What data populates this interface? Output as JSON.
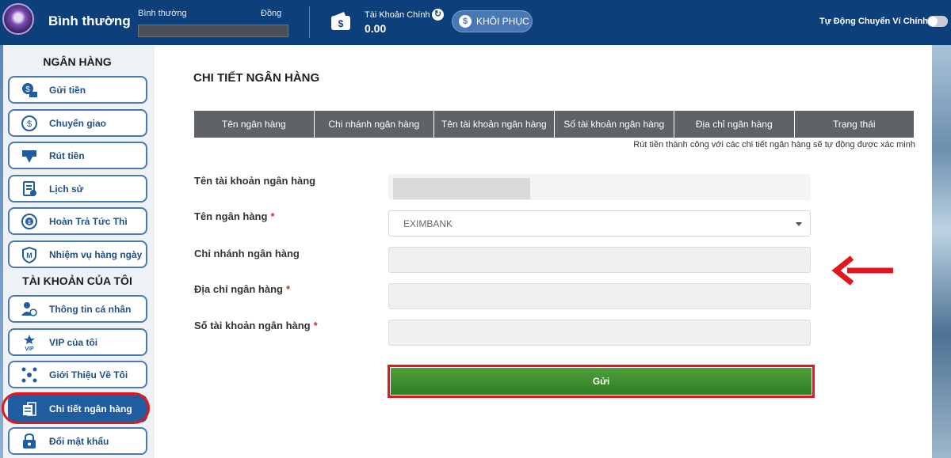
{
  "header": {
    "level_name": "Bình thường",
    "progress_left_label": "Bình thường",
    "progress_right_label": "Đồng",
    "account_label": "Tài Khoản Chính",
    "balance": "0.00",
    "restore_label": "KHÔI PHỤC",
    "auto_switch_label": "Tự Động Chuyển Ví Chính"
  },
  "sidebar": {
    "bank_section_title": "NGÂN HÀNG",
    "bank_items": [
      {
        "label": "Gửi tiền",
        "icon": "deposit-icon"
      },
      {
        "label": "Chuyển giao",
        "icon": "transfer-icon"
      },
      {
        "label": "Rút tiền",
        "icon": "withdraw-icon"
      },
      {
        "label": "Lịch sử",
        "icon": "history-icon"
      },
      {
        "label": "Hoàn Trả Tức Thì",
        "icon": "rebate-icon"
      },
      {
        "label": "Nhiệm vụ hàng ngày",
        "icon": "mission-icon"
      }
    ],
    "account_section_title": "TÀI KHOẢN CỦA TÔI",
    "account_items": [
      {
        "label": "Thông tin cá nhân",
        "icon": "profile-icon"
      },
      {
        "label": "VIP của tôi",
        "icon": "vip-icon"
      },
      {
        "label": "Giới Thiệu Về Tôi",
        "icon": "referral-icon"
      },
      {
        "label": "Chi tiết ngân hàng",
        "icon": "bank-details-icon"
      },
      {
        "label": "Đổi mật khẩu",
        "icon": "lock-icon"
      }
    ]
  },
  "main": {
    "title": "CHI TIẾT NGÂN HÀNG",
    "table_headers": [
      "Tên ngân hàng",
      "Chi nhánh ngân hàng",
      "Tên tài khoản ngân hàng",
      "Số tài khoản ngân hàng",
      "Địa chỉ ngân hàng",
      "Trạng thái"
    ],
    "note": "Rút tiền thành công với các chi tiết ngân hàng sẽ tự động được xác minh",
    "form": {
      "account_name_label": "Tên tài khoản ngân hàng",
      "bank_name_label": "Tên ngân hàng",
      "bank_name_value": "EXIMBANK",
      "branch_label": "Chi nhánh ngân hàng",
      "address_label": "Địa chỉ ngân hàng",
      "account_number_label": "Số tài khoản ngân hàng",
      "required_mark": "*"
    },
    "submit_label": "Gửi"
  },
  "colors": {
    "header_bg": "#0d3f7a",
    "accent_blue": "#1f5da0",
    "highlight_red": "#e4161d",
    "submit_green": "#3b8e2e"
  }
}
